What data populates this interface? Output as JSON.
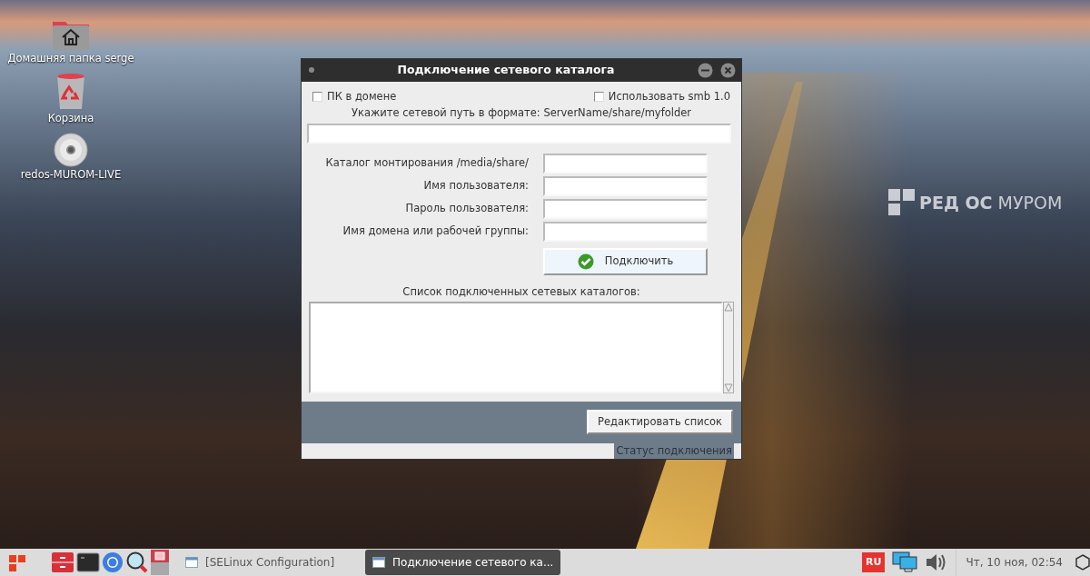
{
  "desktop": {
    "icons": [
      {
        "kind": "home",
        "label": "Домашняя папка serge"
      },
      {
        "kind": "trash",
        "label": "Корзина"
      },
      {
        "kind": "disc",
        "label": "redos-MUROM-LIVE"
      }
    ],
    "wallpaper_logo": "**РЕД ОС** МУРОМ"
  },
  "window": {
    "title": "Подключение сетевого каталога",
    "checkboxes": [
      {
        "label": "ПК в домене",
        "checked": false
      },
      {
        "label": "Использовать smb 1.0",
        "checked": false
      }
    ],
    "path_label": "Укажите сетевой путь в формате: ServerName/share/myfolder",
    "fields": [
      {
        "label": "Каталог монтирования /media/share/"
      },
      {
        "label": "Имя пользователя:"
      },
      {
        "label": "Пароль пользователя:"
      },
      {
        "label": "Имя домена или рабочей группы:"
      }
    ],
    "connect_button": "Подключить",
    "list_label": "Список подключенных сетевых каталогов:",
    "edit_button": "Редактировать список",
    "status": "Статус подключения"
  },
  "taskbar": {
    "windows": [
      {
        "label": "[SELinux Configuration]",
        "selected": false
      },
      {
        "label": "Подключение сетевого ка...",
        "selected": true
      }
    ],
    "keyboard_layout": "RU",
    "clock": "Чт, 10 ноя, 02:54"
  }
}
